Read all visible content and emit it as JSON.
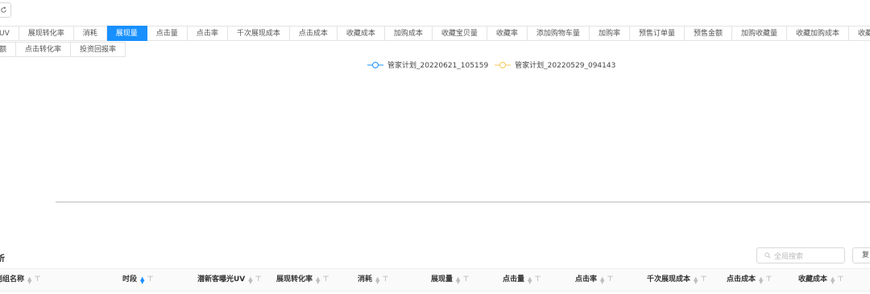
{
  "tabs_row1": [
    "UV",
    "展现转化率",
    "消耗",
    "展现量",
    "点击量",
    "点击率",
    "千次展现成本",
    "点击成本",
    "收藏成本",
    "加购成本",
    "收藏宝贝量",
    "收藏率",
    "添加购物车量",
    "加购率",
    "预售订单量",
    "预售金额",
    "加购收藏量",
    "收藏加购成本",
    "收藏加"
  ],
  "active_tab": "展现量",
  "tabs_row2": [
    "额",
    "点击转化率",
    "投资回报率"
  ],
  "legend": [
    {
      "label": "管家计划_20220621_105159",
      "color": "#1890ff"
    },
    {
      "label": "管家计划_20220529_094143",
      "color": "#fac858"
    }
  ],
  "section_title": "析",
  "search": {
    "placeholder": "全局搜索"
  },
  "copy_label": "复",
  "table_headers": [
    "划组名称",
    "时段",
    "潜新客曝光UV",
    "展现转化率",
    "消耗",
    "展现量",
    "点击量",
    "点击率",
    "千次展现成本",
    "点击成本",
    "收藏成本"
  ]
}
